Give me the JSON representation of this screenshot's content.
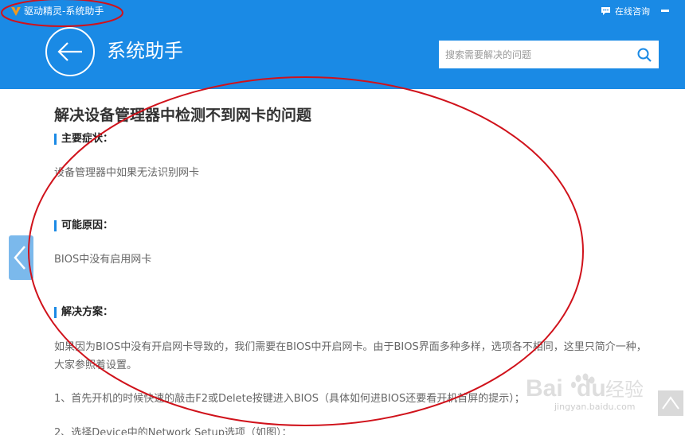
{
  "window": {
    "app_title": "驱动精灵-系统助手",
    "consult_label": "在线咨询"
  },
  "header": {
    "page_title": "系统助手",
    "search_placeholder": "搜索需要解决的问题"
  },
  "article": {
    "title": "解决设备管理器中检测不到网卡的问题",
    "sections": [
      {
        "heading": "主要症状：",
        "text": "设备管理器中如果无法识别网卡"
      },
      {
        "heading": "可能原因：",
        "text": "BIOS中没有启用网卡"
      },
      {
        "heading": "解决方案：",
        "lines": [
          "如果因为BIOS中没有开启网卡导致的，我们需要在BIOS中开启网卡。由于BIOS界面多种多样，选项各不相同，这里只简介一种，",
          "大家参照着设置。",
          "1、首先开机的时候快速的敲击F2或Delete按键进入BIOS（具体如何进BIOS还要看开机首屏的提示）；",
          "2、选择Device中的Network Setup选项（如图）："
        ]
      }
    ]
  },
  "watermark": {
    "brand": "Bai",
    "brand2": "du",
    "suffix": "经验",
    "url": "jingyan.baidu.com"
  },
  "colors": {
    "header_blue": "#1a8ae5",
    "annotation_red": "#d0121b"
  },
  "icons": {
    "logo": "app-logo-icon",
    "chat": "chat-bubble-icon",
    "minimize": "minimize-icon",
    "back": "back-arrow-icon",
    "search": "search-icon",
    "prev": "chevron-left-icon",
    "top": "back-to-top-icon"
  }
}
